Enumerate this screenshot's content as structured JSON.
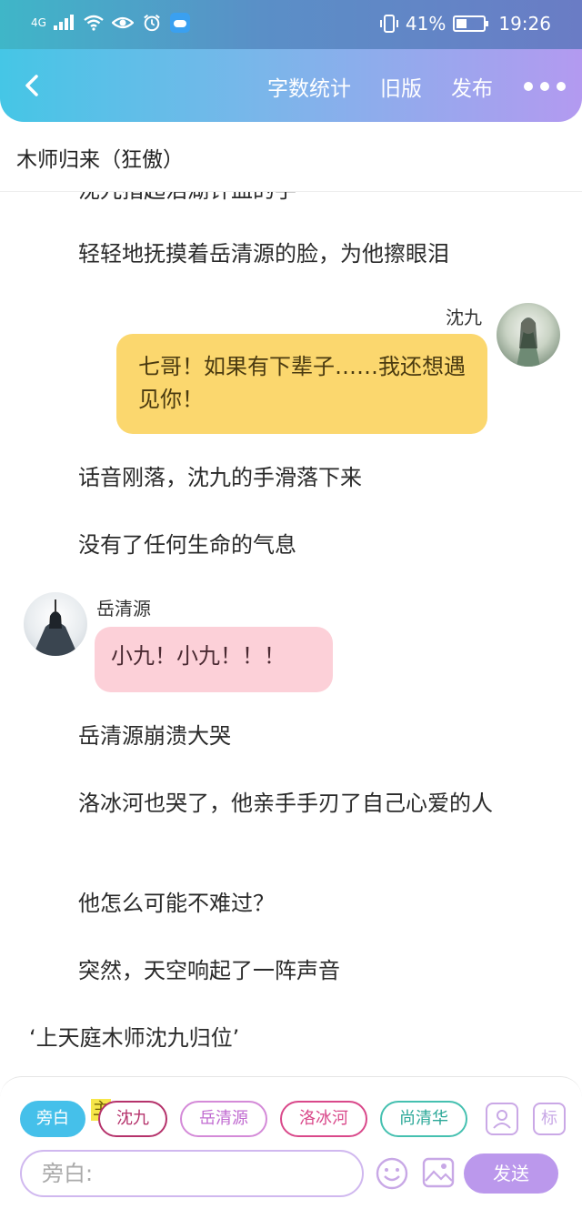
{
  "status_bar": {
    "network": "4G",
    "battery_pct": "41%",
    "battery_level": 0.41,
    "time": "19:26",
    "icons": [
      "signal-icon",
      "wifi-icon",
      "eye-icon",
      "alarm-icon",
      "weather-icon",
      "vibrate-icon",
      "battery-icon"
    ]
  },
  "header": {
    "back_icon": "back-chevron-icon",
    "actions": [
      "字数统计",
      "旧版",
      "发布"
    ],
    "more_icon": "more-dots-icon"
  },
  "book_title": "木师归来（狂傲）",
  "content": {
    "cut_line": "沈九指起泪湖针血的手",
    "line1": "轻轻地抚摸着岳清源的脸，为他擦眼泪",
    "msg_shen": {
      "name": "沈九",
      "text": "七哥！如果有下辈子……我还想遇见你！"
    },
    "line2": "话音刚落，沈九的手滑落下来",
    "line3": "没有了任何生命的气息",
    "msg_yue": {
      "name": "岳清源",
      "text": "小九！小九！！！"
    },
    "line4": "岳清源崩溃大哭",
    "line5": "洛冰河也哭了，他亲手手刃了自己心爱的人",
    "line6": "他怎么可能不难过？",
    "line7": "突然，天空响起了一阵声音",
    "line8": "‘上天庭木师沈九归位’"
  },
  "composer": {
    "chips": [
      "旁白",
      "沈九",
      "岳清源",
      "洛冰河",
      "尚清华"
    ],
    "main_mark": "主",
    "avatar_btn_icon": "person-card-icon",
    "tag_btn": "标",
    "input_placeholder": "旁白:",
    "emoji_icon": "emoji-icon",
    "image_icon": "image-icon",
    "send_label": "发送"
  },
  "colors": {
    "accent_cyan": "#45c0ea",
    "accent_purple": "#bb98ec",
    "bubble_yellow": "#fbd76e",
    "bubble_pink": "#fcd0d8"
  }
}
